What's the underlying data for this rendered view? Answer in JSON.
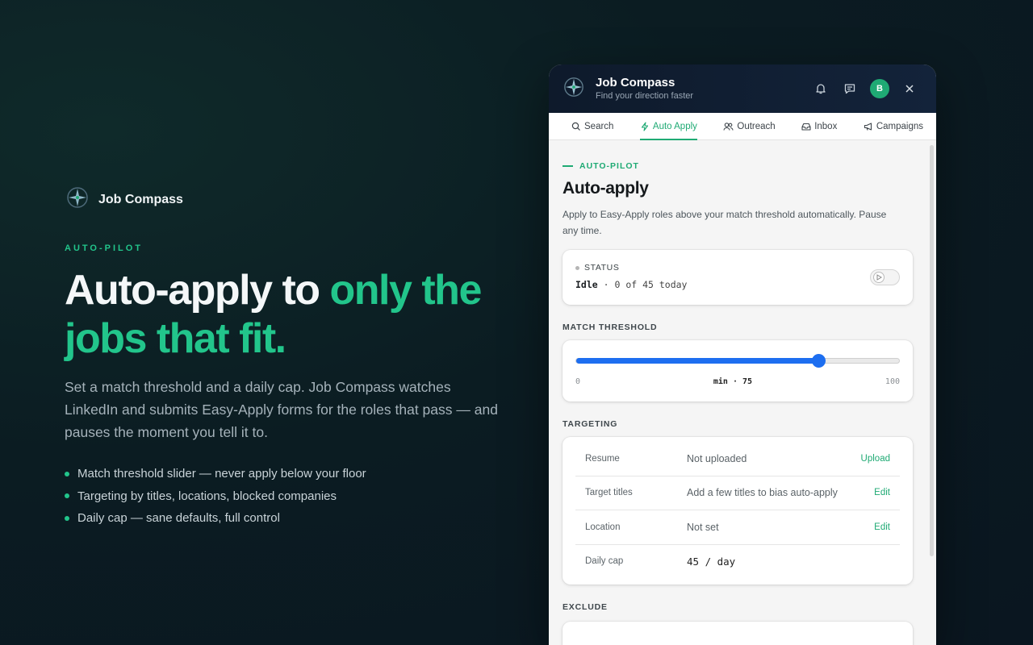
{
  "brand": {
    "name": "Job Compass"
  },
  "hero": {
    "eyebrow": "AUTO-PILOT",
    "headline_part1": "Auto-apply to ",
    "headline_accent": "only the jobs that fit.",
    "lede": "Set a match threshold and a daily cap. Job Compass watches LinkedIn and submits Easy-Apply forms for the roles that pass — and pauses the moment you tell it to.",
    "bullets": [
      "Match threshold slider — never apply below your floor",
      "Targeting by titles, locations, blocked companies",
      "Daily cap — sane defaults, full control"
    ]
  },
  "panel": {
    "title": "Job Compass",
    "subtitle": "Find your direction faster",
    "avatar_initial": "B",
    "tabs": [
      {
        "label": "Search",
        "icon": "search-icon"
      },
      {
        "label": "Auto Apply",
        "icon": "bolt-icon",
        "active": true
      },
      {
        "label": "Outreach",
        "icon": "people-icon"
      },
      {
        "label": "Inbox",
        "icon": "inbox-icon"
      },
      {
        "label": "Campaigns",
        "icon": "megaphone-icon"
      }
    ],
    "eyebrow": "AUTO-PILOT",
    "heading": "Auto-apply",
    "description": "Apply to Easy-Apply roles above your match threshold automatically. Pause any time.",
    "status": {
      "label": "STATUS",
      "state": "Idle",
      "detail": " · 0 of 45 today",
      "running": false
    },
    "threshold": {
      "label": "MATCH THRESHOLD",
      "min": "0",
      "max": "100",
      "value": 75,
      "value_label": "min · 75"
    },
    "targeting": {
      "label": "TARGETING",
      "rows": [
        {
          "key": "Resume",
          "value": "Not uploaded",
          "action": "Upload"
        },
        {
          "key": "Target titles",
          "value": "Add a few titles to bias auto-apply",
          "action": "Edit"
        },
        {
          "key": "Location",
          "value": "Not set",
          "action": "Edit"
        },
        {
          "key": "Daily cap",
          "value": "45 / day",
          "action": ""
        }
      ]
    },
    "exclude": {
      "label": "EXCLUDE"
    }
  },
  "colors": {
    "accent": "#22c58b",
    "slider": "#1d6ef0",
    "header_bg": "#0e1a2b"
  }
}
